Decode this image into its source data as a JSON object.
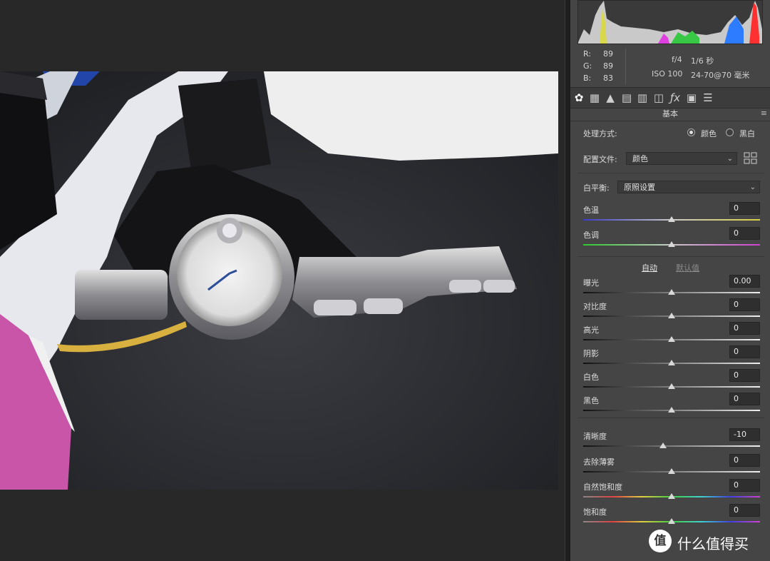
{
  "histogram_info": {
    "r_label": "R:",
    "r": "89",
    "g_label": "G:",
    "g": "89",
    "b_label": "B:",
    "b": "83",
    "aperture": "f/4",
    "shutter": "1/6 秒",
    "iso": "ISO 100",
    "lens": "24-70@70 毫米"
  },
  "toolbar": {
    "icons": [
      "basic-icon",
      "tone-curve-icon",
      "detail-icon",
      "hsl-icon",
      "split-toning-icon",
      "lens-corrections-icon",
      "effects-icon",
      "camera-calibration-icon",
      "presets-icon"
    ]
  },
  "panel": {
    "title": "基本",
    "menu": "≡",
    "treatment_label": "处理方式:",
    "treatment_color": "颜色",
    "treatment_bw": "黑白",
    "treatment_selected": "颜色",
    "profile_label": "配置文件:",
    "profile_value": "颜色",
    "wb_label": "白平衡:",
    "wb_value": "原照设置",
    "auto": "自动",
    "default": "默认值"
  },
  "sliders": [
    {
      "label": "色温",
      "value": "0",
      "level": 0.5
    },
    {
      "label": "色调",
      "value": "0",
      "level": 0.5
    },
    {
      "label": "曝光",
      "value": "0.00",
      "level": 0.5
    },
    {
      "label": "对比度",
      "value": "0",
      "level": 0.5
    },
    {
      "label": "高光",
      "value": "0",
      "level": 0.5
    },
    {
      "label": "阴影",
      "value": "0",
      "level": 0.5
    },
    {
      "label": "白色",
      "value": "0",
      "level": 0.5
    },
    {
      "label": "黑色",
      "value": "0",
      "level": 0.5
    },
    {
      "label": "清晰度",
      "value": "-10",
      "level": 0.45
    },
    {
      "label": "去除薄雾",
      "value": "0",
      "level": 0.5
    },
    {
      "label": "自然饱和度",
      "value": "0",
      "level": 0.5
    },
    {
      "label": "饱和度",
      "value": "0",
      "level": 0.5
    }
  ],
  "watermark": {
    "text": "什么值得买",
    "symbol": "值"
  },
  "colors": {
    "panel": "#454545",
    "canvas": "#282828",
    "accent": "#ffffff"
  }
}
